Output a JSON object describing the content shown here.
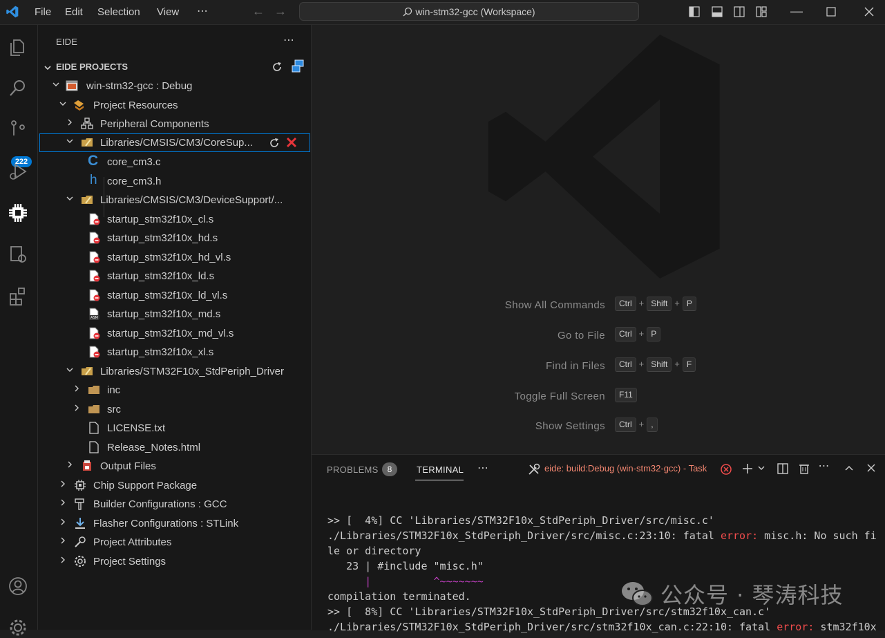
{
  "titlebar": {
    "menu": [
      "File",
      "Edit",
      "Selection",
      "View",
      "⋯"
    ],
    "command_center": "win-stm32-gcc (Workspace)"
  },
  "activity": {
    "source_control_badge": "222"
  },
  "sidebar": {
    "title": "EIDE",
    "more": "⋯",
    "section": "EIDE PROJECTS",
    "tree": [
      {
        "label": "win-stm32-gcc : Debug",
        "icon": "project-icon"
      },
      {
        "label": "Project Resources",
        "icon": "resources-icon"
      },
      {
        "label": "Peripheral Components",
        "icon": "components-icon"
      },
      {
        "label": "Libraries/CMSIS/CM3/CoreSup...",
        "icon": "folder-lib-icon"
      },
      {
        "label": "core_cm3.c",
        "icon": "c-file-icon"
      },
      {
        "label": "core_cm3.h",
        "icon": "h-file-icon"
      },
      {
        "label": "Libraries/CMSIS/CM3/DeviceSupport/...",
        "icon": "folder-lib-icon"
      },
      {
        "label": "startup_stm32f10x_cl.s",
        "icon": "excluded-file-icon"
      },
      {
        "label": "startup_stm32f10x_hd.s",
        "icon": "excluded-file-icon"
      },
      {
        "label": "startup_stm32f10x_hd_vl.s",
        "icon": "excluded-file-icon"
      },
      {
        "label": "startup_stm32f10x_ld.s",
        "icon": "excluded-file-icon"
      },
      {
        "label": "startup_stm32f10x_ld_vl.s",
        "icon": "excluded-file-icon"
      },
      {
        "label": "startup_stm32f10x_md.s",
        "icon": "asm-file-icon"
      },
      {
        "label": "startup_stm32f10x_md_vl.s",
        "icon": "excluded-file-icon"
      },
      {
        "label": "startup_stm32f10x_xl.s",
        "icon": "excluded-file-icon"
      },
      {
        "label": "Libraries/STM32F10x_StdPeriph_Driver",
        "icon": "folder-lib-icon"
      },
      {
        "label": "inc",
        "icon": "folder-icon"
      },
      {
        "label": "src",
        "icon": "folder-icon"
      },
      {
        "label": "LICENSE.txt",
        "icon": "file-icon"
      },
      {
        "label": "Release_Notes.html",
        "icon": "file-icon"
      },
      {
        "label": "Output Files",
        "icon": "output-icon"
      },
      {
        "label": "Chip Support Package",
        "icon": "chip-icon"
      },
      {
        "label": "Builder Configurations : GCC",
        "icon": "hammer-icon"
      },
      {
        "label": "Flasher Configurations : STLink",
        "icon": "download-icon"
      },
      {
        "label": "Project Attributes",
        "icon": "wrench-icon"
      },
      {
        "label": "Project Settings",
        "icon": "gear-icon"
      }
    ]
  },
  "editor": {
    "hints": [
      {
        "label": "Show All Commands",
        "keys": [
          "Ctrl",
          "Shift",
          "P"
        ]
      },
      {
        "label": "Go to File",
        "keys": [
          "Ctrl",
          "P"
        ]
      },
      {
        "label": "Find in Files",
        "keys": [
          "Ctrl",
          "Shift",
          "F"
        ]
      },
      {
        "label": "Toggle Full Screen",
        "keys": [
          "F11"
        ]
      },
      {
        "label": "Show Settings",
        "keys": [
          "Ctrl",
          ","
        ]
      }
    ]
  },
  "panel": {
    "tabs": [
      "PROBLEMS",
      "TERMINAL"
    ],
    "problems_count": "8",
    "more": "⋯",
    "task_label": "eide: build:Debug (win-stm32-gcc) - Task",
    "terminal": {
      "l1": ">> [  4%] CC 'Libraries/STM32F10x_StdPeriph_Driver/src/misc.c'",
      "l2a": "./Libraries/STM32F10x_StdPeriph_Driver/src/misc.c:23:10: fatal ",
      "l2b": "error:",
      "l2c": " misc.h: No such fi",
      "l3": "le or directory",
      "l4a": "   23 | #include ",
      "l4b": "\"misc.h\"",
      "l5a": "      |          ",
      "l5b": "^~~~~~~~",
      "l6": "compilation terminated.",
      "l7": ">> [  8%] CC 'Libraries/STM32F10x_StdPeriph_Driver/src/stm32f10x_can.c'",
      "l8a": "./Libraries/STM32F10x_StdPeriph_Driver/src/stm32f10x_can.c:22:10: fatal ",
      "l8b": "error:",
      "l8c": " stm32f10x"
    }
  },
  "watermark": "公众号 · 琴涛科技",
  "colors": {
    "accent": "#0078d4",
    "error": "#f14c4c",
    "bg": "#1f1f1f",
    "sidebar": "#181818"
  }
}
